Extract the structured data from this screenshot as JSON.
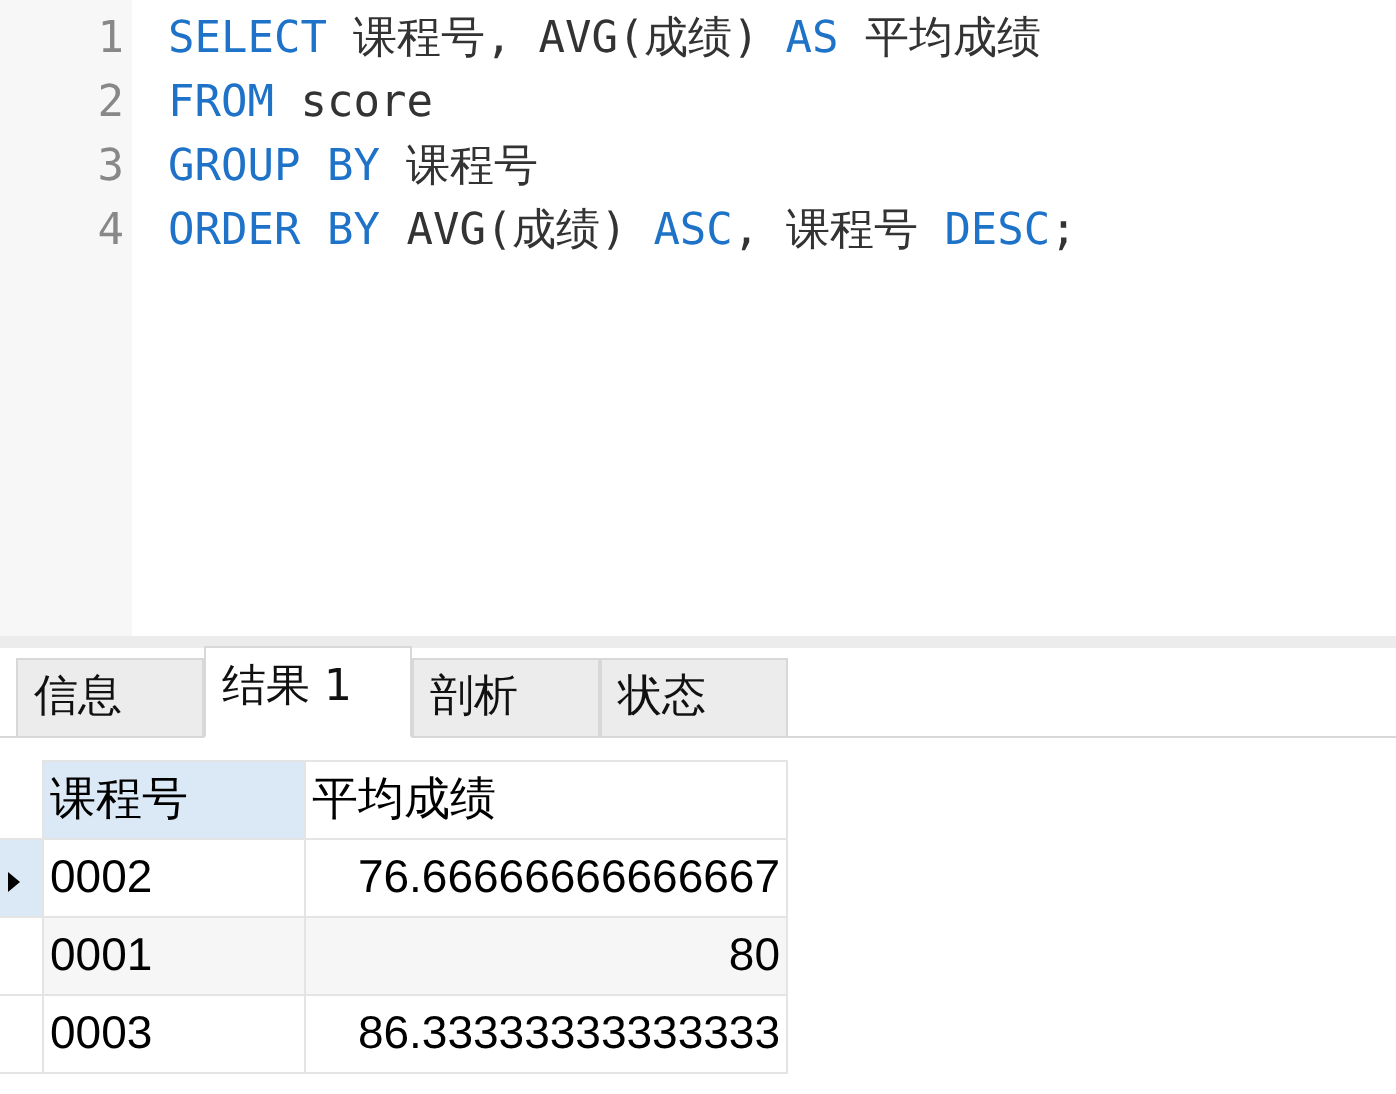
{
  "editor": {
    "lines": [
      {
        "number": "1",
        "tokens": [
          {
            "kind": "keyword",
            "text": "SELECT"
          },
          {
            "kind": "text",
            "text": " 课程号, AVG(成绩) "
          },
          {
            "kind": "keyword",
            "text": "AS"
          },
          {
            "kind": "text",
            "text": " 平均成绩"
          }
        ]
      },
      {
        "number": "2",
        "tokens": [
          {
            "kind": "keyword",
            "text": "FROM"
          },
          {
            "kind": "text",
            "text": " score"
          }
        ]
      },
      {
        "number": "3",
        "tokens": [
          {
            "kind": "keyword",
            "text": "GROUP BY"
          },
          {
            "kind": "text",
            "text": " 课程号"
          }
        ]
      },
      {
        "number": "4",
        "tokens": [
          {
            "kind": "keyword",
            "text": "ORDER BY"
          },
          {
            "kind": "text",
            "text": " AVG(成绩) "
          },
          {
            "kind": "keyword",
            "text": "ASC"
          },
          {
            "kind": "text",
            "text": ", 课程号 "
          },
          {
            "kind": "keyword",
            "text": "DESC"
          },
          {
            "kind": "text",
            "text": ";"
          }
        ]
      }
    ]
  },
  "tabs": [
    {
      "label": "信息",
      "selected": false
    },
    {
      "label": "结果 1",
      "selected": true
    },
    {
      "label": "剖析",
      "selected": false
    },
    {
      "label": "状态",
      "selected": false
    }
  ],
  "grid": {
    "columns": [
      {
        "label": "课程号",
        "selected": true,
        "right_aligned": false
      },
      {
        "label": "平均成绩",
        "selected": false,
        "right_aligned": true
      }
    ],
    "rows": [
      {
        "selected": true,
        "cells": [
          "0002",
          "76.66666666666667"
        ]
      },
      {
        "selected": false,
        "cells": [
          "0001",
          "80"
        ]
      },
      {
        "selected": false,
        "cells": [
          "0003",
          "86.33333333333333"
        ]
      }
    ]
  }
}
